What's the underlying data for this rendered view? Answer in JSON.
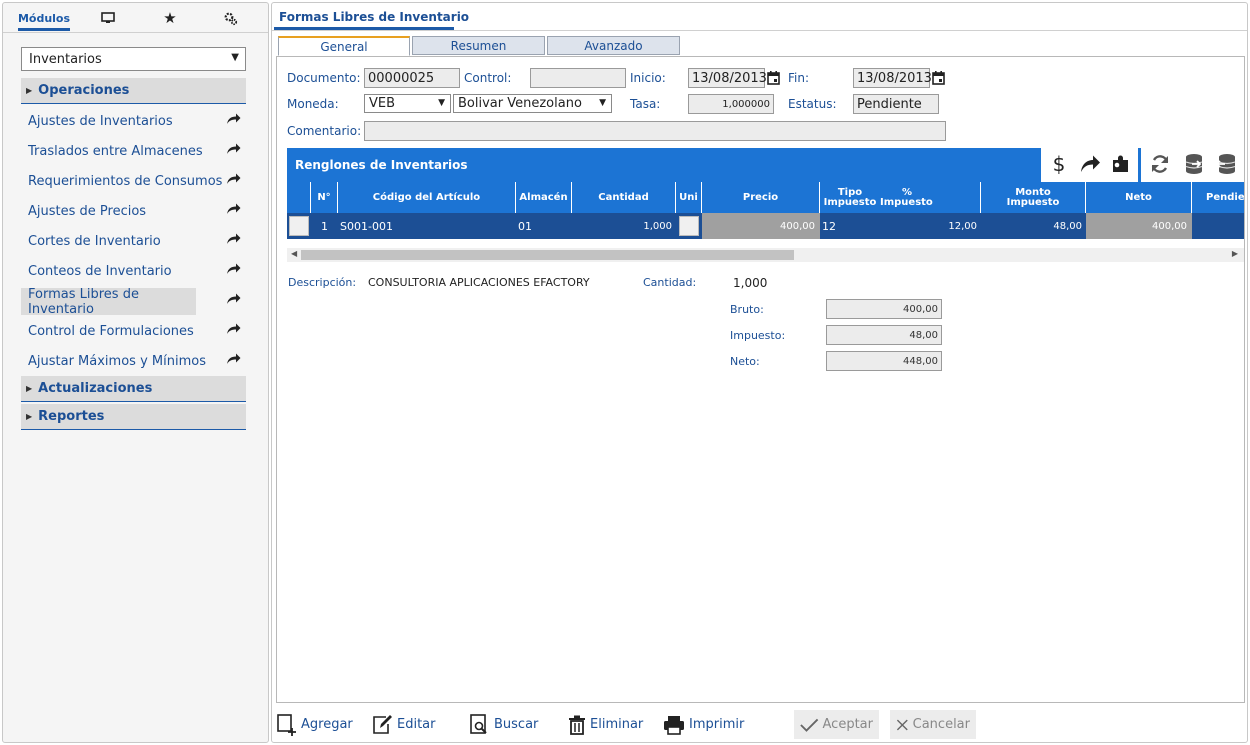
{
  "left": {
    "tabs": [
      {
        "label": "Módulos",
        "icon": ""
      },
      {
        "label": "",
        "icon": "monitor-icon"
      },
      {
        "label": "",
        "icon": "star-icon"
      },
      {
        "label": "",
        "icon": "gears-icon"
      }
    ],
    "module_select": "Inventarios",
    "sections": {
      "operaciones": "Operaciones",
      "actualizaciones": "Actualizaciones",
      "reportes": "Reportes"
    },
    "items": [
      "Ajustes de Inventarios",
      "Traslados entre Almacenes",
      "Requerimientos de Consumos",
      "Ajustes de Precios",
      "Cortes de Inventario",
      "Conteos de Inventario",
      "Formas Libres de Inventario",
      "Control de Formulaciones",
      "Ajustar Máximos y Mínimos"
    ]
  },
  "right": {
    "title": "Formas Libres de Inventario",
    "tabs": [
      "General",
      "Resumen",
      "Avanzado"
    ],
    "form": {
      "documento_label": "Documento:",
      "documento": "00000025",
      "control_label": "Control:",
      "control": "",
      "inicio_label": "Inicio:",
      "inicio": "13/08/2013",
      "fin_label": "Fin:",
      "fin": "13/08/2013",
      "moneda_label": "Moneda:",
      "moneda_code": "VEB",
      "moneda_name": "Bolivar Venezolano",
      "tasa_label": "Tasa:",
      "tasa": "1,000000",
      "estatus_label": "Estatus:",
      "estatus": "Pendiente",
      "comentario_label": "Comentario:",
      "comentario": ""
    },
    "grid": {
      "title": "Renglones de Inventarios",
      "toolbar_icons": [
        "dollar-icon",
        "share-arrow-icon",
        "puzzle-icon",
        "refresh-icon",
        "database-export-icon",
        "database-import-icon"
      ],
      "headers": {
        "n": "N°",
        "codigo": "Código del Artículo",
        "almacen": "Almacén",
        "cantidad": "Cantidad",
        "uni": "Uni",
        "precio": "Precio",
        "tipo_impuesto_1": "Tipo",
        "tipo_impuesto_2": "Impuesto",
        "pct_impuesto_1": "%",
        "pct_impuesto_2": "Impuesto",
        "monto_impuesto_1": "Monto",
        "monto_impuesto_2": "Impuesto",
        "neto": "Neto",
        "pendiente": "Pendie"
      },
      "rows": [
        {
          "n": "1",
          "codigo": "S001-001",
          "almacen": "01",
          "cantidad": "1,000",
          "uni": "",
          "precio": "400,00",
          "tipo_impuesto": "12",
          "pct_impuesto": "12,00",
          "monto_impuesto": "48,00",
          "neto": "400,00"
        }
      ]
    },
    "footer": {
      "descripcion_label": "Descripción:",
      "descripcion": "CONSULTORIA APLICACIONES EFACTORY",
      "cantidad_label": "Cantidad:",
      "cantidad": "1,000",
      "bruto_label": "Bruto:",
      "bruto": "400,00",
      "impuesto_label": "Impuesto:",
      "impuesto": "48,00",
      "neto_label": "Neto:",
      "neto": "448,00"
    },
    "actions": {
      "agregar": "Agregar",
      "editar": "Editar",
      "buscar": "Buscar",
      "eliminar": "Eliminar",
      "imprimir": "Imprimir",
      "aceptar": "Aceptar",
      "cancelar": "Cancelar"
    },
    "colors": {
      "accent": "#1c74d4",
      "dark_blue": "#1c4f95",
      "tab_highlight": "#e8a020"
    }
  }
}
